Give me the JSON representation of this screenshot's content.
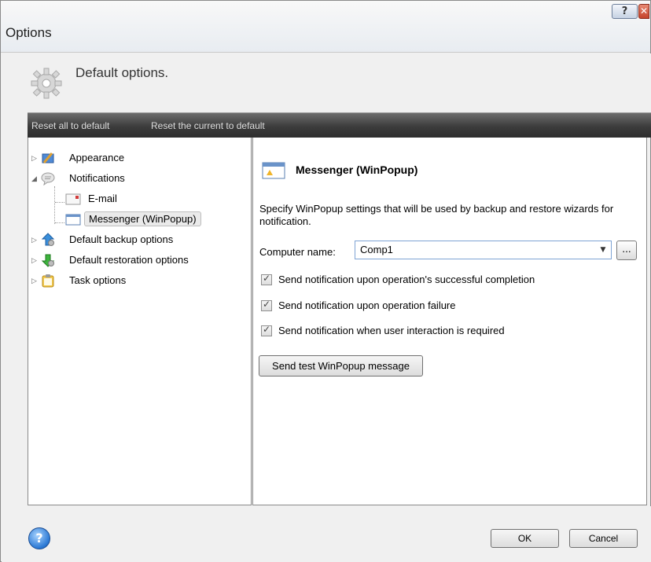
{
  "window": {
    "title": "Options",
    "help_button": "?",
    "close_button": "✕"
  },
  "header": {
    "text": "Default options."
  },
  "toolbar": {
    "reset_all": "Reset all to default",
    "reset_current": "Reset the current to default"
  },
  "tree": {
    "items": [
      {
        "label": "Appearance",
        "icon": "appearance-icon"
      },
      {
        "label": "Notifications",
        "icon": "notifications-icon"
      },
      {
        "label": "E-mail",
        "icon": "email-icon"
      },
      {
        "label": "Messenger (WinPopup)",
        "icon": "messenger-icon",
        "selected": true
      },
      {
        "label": "Default backup options",
        "icon": "backup-icon"
      },
      {
        "label": "Default restoration options",
        "icon": "restore-icon"
      },
      {
        "label": "Task options",
        "icon": "task-icon"
      }
    ]
  },
  "content": {
    "title": "Messenger (WinPopup)",
    "description": "Specify WinPopup settings that will be used by backup and restore wizards for notification.",
    "computer_name_label": "Computer name:",
    "computer_name_value": "Comp1",
    "browse_label": "...",
    "checkboxes": [
      {
        "label": "Send notification upon operation's successful completion",
        "checked": true
      },
      {
        "label": "Send notification upon operation failure",
        "checked": true
      },
      {
        "label": "Send notification when user interaction is required",
        "checked": true
      }
    ],
    "test_button": "Send test WinPopup message"
  },
  "footer": {
    "help": "?",
    "ok": "OK",
    "cancel": "Cancel"
  }
}
